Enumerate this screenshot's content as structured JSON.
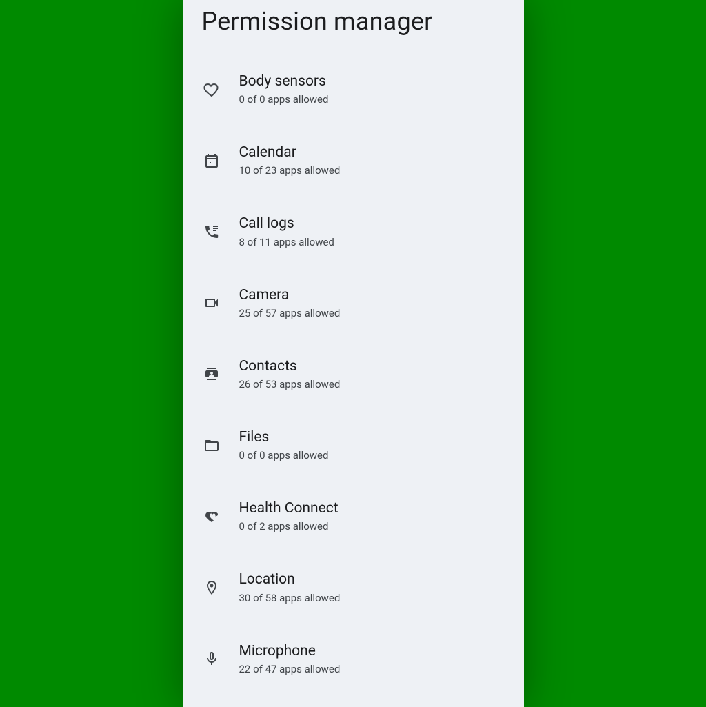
{
  "title": "Permission manager",
  "items": [
    {
      "label": "Body sensors",
      "sub": "0 of 0 apps allowed"
    },
    {
      "label": "Calendar",
      "sub": "10 of 23 apps allowed"
    },
    {
      "label": "Call logs",
      "sub": "8 of 11 apps allowed"
    },
    {
      "label": "Camera",
      "sub": "25 of 57 apps allowed"
    },
    {
      "label": "Contacts",
      "sub": "26 of 53 apps allowed"
    },
    {
      "label": "Files",
      "sub": "0 of 0 apps allowed"
    },
    {
      "label": "Health Connect",
      "sub": "0 of 2 apps allowed"
    },
    {
      "label": "Location",
      "sub": "30 of 58 apps allowed"
    },
    {
      "label": "Microphone",
      "sub": "22 of 47 apps allowed"
    }
  ]
}
